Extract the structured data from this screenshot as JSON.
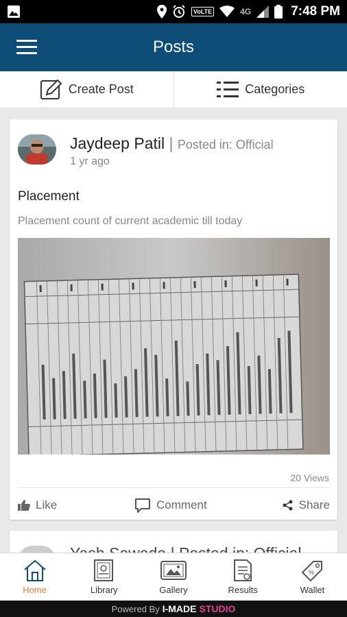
{
  "status_bar": {
    "time": "7:48 PM",
    "volte": "VoLTE",
    "network": "4G"
  },
  "app_bar": {
    "title": "Posts"
  },
  "actions": {
    "create_post": "Create Post",
    "categories": "Categories"
  },
  "posts": [
    {
      "author": "Jaydeep Patil",
      "separator": "|",
      "posted_in": "Posted in: Official",
      "time_ago": "1 yr ago",
      "title": "Placement",
      "description": "Placement count of current academic till today",
      "views": "20 Views",
      "like": "Like",
      "comment": "Comment",
      "share": "Share"
    },
    {
      "author": "Yash Sawade | Posted in: Official"
    }
  ],
  "bottom_nav": [
    {
      "label": "Home",
      "icon": "home-icon"
    },
    {
      "label": "Library",
      "icon": "library-icon"
    },
    {
      "label": "Gallery",
      "icon": "gallery-icon"
    },
    {
      "label": "Results",
      "icon": "results-icon"
    },
    {
      "label": "Wallet",
      "icon": "wallet-icon"
    }
  ],
  "footer": {
    "powered_by": "Powered By",
    "brand": "I-MADE",
    "brand2": "STUDIO"
  },
  "colors": {
    "app_bar": "#0e4d78",
    "active_nav": "#f07b2c",
    "background": "#e9e9e9"
  }
}
